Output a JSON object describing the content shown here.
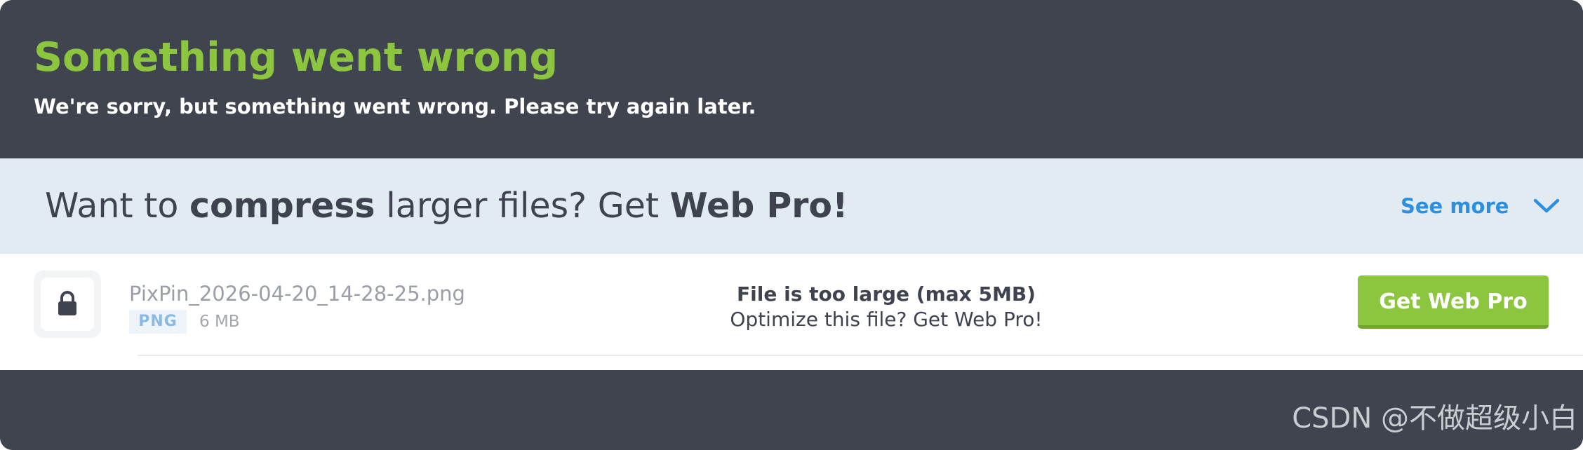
{
  "error": {
    "title": "Something went wrong",
    "message": "We're sorry, but something went wrong. Please try again later."
  },
  "promo": {
    "text_prefix": "Want to ",
    "text_bold1": "compress",
    "text_middle": " larger files? Get ",
    "text_bold2": "Web Pro!",
    "see_more_label": "See more",
    "see_more_icon": "chevron-down-icon"
  },
  "file": {
    "icon": "lock-icon",
    "name": "PixPin_2026-04-20_14-28-25.png",
    "type": "PNG",
    "size": "6 MB",
    "status_title": "File is too large (max 5MB)",
    "status_subtitle": "Optimize this file? Get Web Pro!",
    "action_label": "Get Web Pro"
  },
  "watermark": "CSDN @不做超级小白",
  "colors": {
    "accent_green": "#8cc63f",
    "dark_background": "#40444f",
    "banner_background": "#e3ebf2",
    "link_blue": "#2d8fde",
    "badge_text": "#8ab9e4"
  }
}
